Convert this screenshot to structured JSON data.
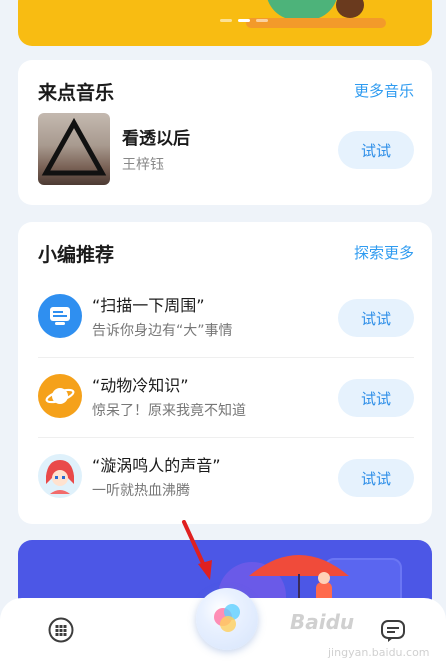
{
  "top_banner": {
    "page_indicator": {
      "count": 3,
      "active_index": 1
    }
  },
  "music_section": {
    "title": "来点音乐",
    "more_label": "更多音乐",
    "song": {
      "name": "看透以后",
      "artist": "王梓钰",
      "try_label": "试试"
    }
  },
  "recommend_section": {
    "title": "小编推荐",
    "more_label": "探索更多",
    "items": [
      {
        "title": "“扫描一下周围”",
        "subtitle": "告诉你身边有“大”事情",
        "icon": "scan-icon",
        "icon_color": "#2f8ff0",
        "try_label": "试试"
      },
      {
        "title": "“动物冷知识”",
        "subtitle": "惊呆了！原来我竟不知道",
        "icon": "planet-icon",
        "icon_color": "#f5a11a",
        "try_label": "试试"
      },
      {
        "title": "“漩涡鸣人的声音”",
        "subtitle": "一听就热血沸腾",
        "icon": "character-avatar",
        "icon_color": "#e94a4a",
        "try_label": "试试"
      }
    ]
  },
  "bottom_nav": {
    "left_icon": "apps-grid-icon",
    "center_icon": "voice-assistant-orb",
    "right_icon": "chat-icon"
  },
  "watermark": {
    "brand": "Baidu",
    "sub": "jingyan.baidu.com"
  },
  "colors": {
    "accent": "#2f9bf0",
    "banner_yellow": "#f8bc12",
    "banner_blue": "#4c57e6",
    "annotation_red": "#e02020"
  }
}
